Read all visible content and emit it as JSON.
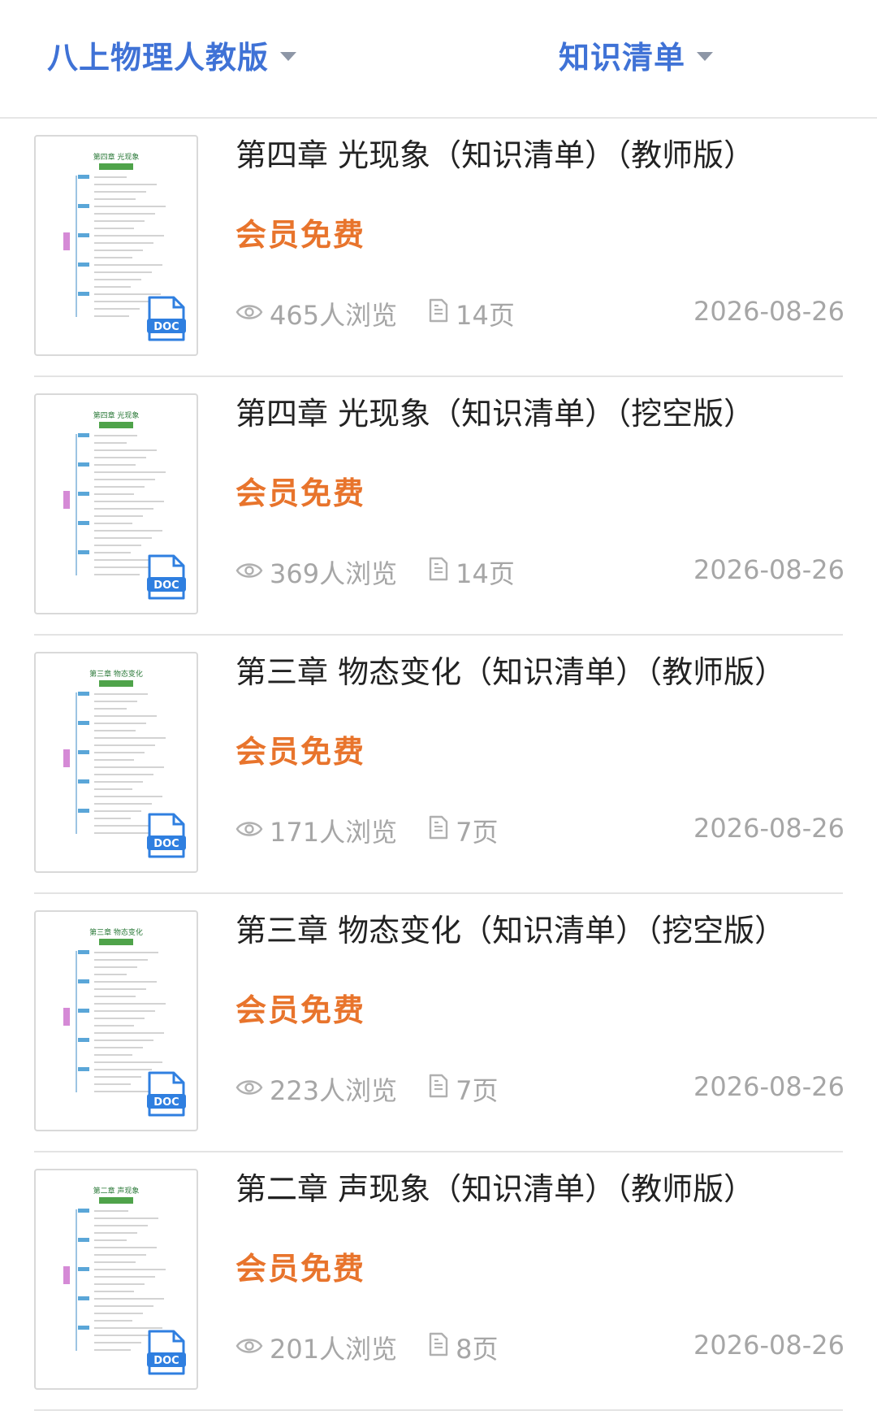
{
  "header": {
    "grade_filter": "八上物理人教版",
    "type_filter": "知识清单"
  },
  "items": [
    {
      "title": "第四章 光现象（知识清单）（教师版）",
      "price": "会员免费",
      "views": "465人浏览",
      "pages": "14页",
      "date": "2026-08-26",
      "thumb_heading": "第四章  光现象",
      "thumb_badge": "DOC"
    },
    {
      "title": "第四章 光现象（知识清单）（挖空版）",
      "price": "会员免费",
      "views": "369人浏览",
      "pages": "14页",
      "date": "2026-08-26",
      "thumb_heading": "第四章  光现象",
      "thumb_badge": "DOC"
    },
    {
      "title": "第三章 物态变化（知识清单）（教师版）",
      "price": "会员免费",
      "views": "171人浏览",
      "pages": "7页",
      "date": "2026-08-26",
      "thumb_heading": "第三章  物态变化",
      "thumb_badge": "DOC"
    },
    {
      "title": "第三章 物态变化（知识清单）（挖空版）",
      "price": "会员免费",
      "views": "223人浏览",
      "pages": "7页",
      "date": "2026-08-26",
      "thumb_heading": "第三章  物态变化",
      "thumb_badge": "DOC"
    },
    {
      "title": "第二章 声现象（知识清单）（教师版）",
      "price": "会员免费",
      "views": "201人浏览",
      "pages": "8页",
      "date": "2026-08-26",
      "thumb_heading": "第二章  声现象",
      "thumb_badge": "DOC"
    }
  ],
  "colors": {
    "accent_blue": "#3f72d6",
    "price_orange": "#e8742c",
    "meta_gray": "#a6a6a6",
    "doc_blue": "#2f7fe0"
  },
  "icons": {
    "views": "eye-icon",
    "pages": "document-icon",
    "filter": "caret-down-icon",
    "file_type": "doc-file-icon"
  }
}
